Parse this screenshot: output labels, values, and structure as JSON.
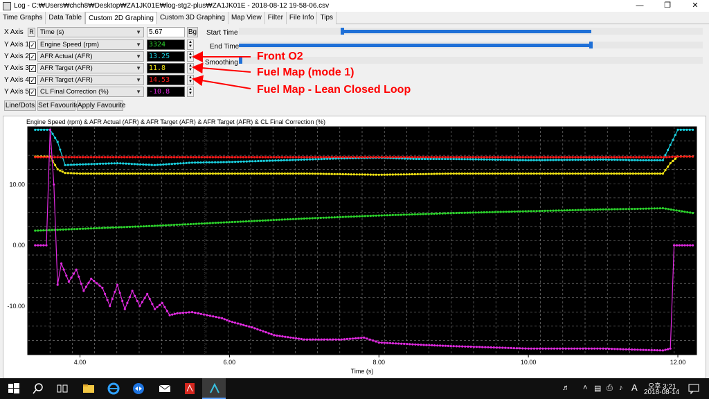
{
  "window": {
    "title": "Log - C:₩Users₩chch8₩Desktop₩ZA1JK01E₩log-stg2-plus₩ZA1JK01E - 2018-08-12 19-58-06.csv",
    "minimize": "—",
    "restore": "❐",
    "close": "✕"
  },
  "tabs": [
    "Time Graphs",
    "Data Table",
    "Custom 2D Graphing",
    "Custom 3D Graphing",
    "Map View",
    "Filter",
    "File Info",
    "Tips"
  ],
  "active_tab": "Custom 2D Graphing",
  "axes_panel": {
    "x_axis": {
      "label": "X Axis",
      "r_button": "R",
      "field": "Time (s)",
      "value": "5.67",
      "bg_button": "Bg"
    },
    "y_axes": [
      {
        "label": "Y Axis 1",
        "field": "Engine Speed (rpm)",
        "value": "3324",
        "color": "#2bd12b"
      },
      {
        "label": "Y Axis 2",
        "field": "AFR Actual (AFR)",
        "value": "13.25",
        "color": "#19d1e0"
      },
      {
        "label": "Y Axis 3",
        "field": "AFR Target (AFR)",
        "value": "11.8",
        "color": "#f2e414"
      },
      {
        "label": "Y Axis 4",
        "field": "AFR Target (AFR)",
        "value": "14.53",
        "color": "#ff1a1a"
      },
      {
        "label": "Y Axis 5",
        "field": "CL Final Correction (%)",
        "value": "-10.8",
        "color": "#e02ae0"
      }
    ],
    "buttons": {
      "line_dots": "Line/Dots",
      "set_favourite": "Set Favourite",
      "apply_favourite": "Apply Favourite"
    }
  },
  "time_controls": {
    "start_time_label": "Start Time",
    "end_time_label": "End Time",
    "smoothing_label": "Smoothing",
    "start_range": [
      0.22,
      0.76
    ],
    "end_range": [
      0.0,
      0.76
    ]
  },
  "annotations": [
    "Front O2",
    "Fuel Map (mode 1)",
    "Fuel Map - Lean Closed Loop"
  ],
  "annotation_color": "#ff0000",
  "chart_data": {
    "type": "line",
    "title": "Engine Speed (rpm) & AFR Actual (AFR) & AFR Target (AFR) & AFR Target (AFR) & CL Final Correction (%)",
    "xlabel": "Time (s)",
    "ylabel": "",
    "xlim": [
      3.3,
      12.25
    ],
    "ylim": [
      -18,
      19.5
    ],
    "xticks": [
      4.0,
      6.0,
      8.0,
      10.0,
      12.0
    ],
    "xtick_labels": [
      "4.00",
      "6.00",
      "8.00",
      "10.00",
      "12.00"
    ],
    "yticks": [
      10,
      0,
      -10
    ],
    "ytick_labels": [
      "10.00",
      "0.00",
      "-10.00"
    ],
    "background": "#000000",
    "grid": true,
    "cursor_x": 5.67,
    "series": [
      {
        "color": "#2bd12b",
        "x": [
          3.4,
          4.0,
          5.0,
          6.0,
          7.0,
          8.0,
          9.0,
          10.0,
          11.0,
          11.5,
          11.8,
          12.2
        ],
        "y": [
          2.4,
          2.7,
          3.2,
          3.8,
          4.4,
          4.9,
          5.3,
          5.6,
          5.9,
          6.0,
          6.1,
          5.3
        ]
      },
      {
        "color": "#19d1e0",
        "x": [
          3.4,
          3.6,
          3.7,
          3.8,
          4.0,
          4.5,
          5.0,
          5.5,
          6.0,
          6.5,
          7.0,
          7.5,
          8.0,
          8.5,
          9.0,
          10.0,
          11.0,
          11.5,
          11.8,
          11.9,
          12.0,
          12.2
        ],
        "y": [
          19.0,
          19.0,
          17.0,
          13.2,
          13.3,
          13.5,
          13.2,
          13.6,
          13.7,
          13.9,
          14.1,
          14.3,
          14.4,
          14.2,
          14.2,
          14.0,
          14.1,
          14.0,
          14.0,
          16.5,
          19.0,
          19.0
        ]
      },
      {
        "color": "#f2e414",
        "x": [
          3.4,
          3.6,
          3.7,
          3.8,
          4.0,
          5.0,
          6.0,
          7.0,
          8.0,
          9.0,
          10.0,
          11.0,
          11.8,
          11.9,
          12.0,
          12.2
        ],
        "y": [
          14.6,
          14.6,
          12.5,
          11.9,
          11.8,
          11.8,
          11.8,
          11.8,
          11.6,
          11.8,
          11.8,
          11.8,
          11.8,
          13.5,
          14.6,
          14.6
        ]
      },
      {
        "color": "#ff1a1a",
        "x": [
          3.4,
          3.7,
          4.0,
          6.0,
          8.0,
          10.0,
          11.85,
          12.0,
          12.2
        ],
        "y": [
          14.5,
          14.5,
          14.5,
          14.5,
          14.5,
          14.5,
          14.5,
          14.6,
          14.6
        ]
      },
      {
        "color": "#e02ae0",
        "x": [
          3.4,
          3.55,
          3.6,
          3.65,
          3.7,
          3.75,
          3.85,
          3.95,
          4.05,
          4.15,
          4.3,
          4.4,
          4.5,
          4.6,
          4.7,
          4.8,
          4.9,
          5.0,
          5.1,
          5.2,
          5.3,
          5.5,
          5.7,
          5.9,
          6.0,
          6.3,
          6.6,
          7.0,
          7.5,
          7.8,
          8.0,
          8.3,
          8.6,
          9.0,
          9.5,
          10.0,
          10.5,
          11.0,
          11.5,
          11.8,
          11.9,
          11.95,
          12.2
        ],
        "y": [
          0,
          0,
          19.0,
          10.0,
          -6.5,
          -3.0,
          -6.0,
          -4.0,
          -7.5,
          -5.5,
          -7.0,
          -10.0,
          -6.5,
          -10.5,
          -7.5,
          -10.0,
          -8.0,
          -10.5,
          -9.5,
          -11.5,
          -11.2,
          -11.0,
          -11.5,
          -12.0,
          -12.5,
          -13.5,
          -14.8,
          -15.5,
          -15.5,
          -15.2,
          -16.0,
          -16.2,
          -16.4,
          -16.6,
          -16.8,
          -17.0,
          -17.0,
          -17.0,
          -17.2,
          -17.3,
          -17.0,
          0,
          0
        ]
      }
    ]
  },
  "taskbar": {
    "time": "오후 3:21",
    "date": "2018-08-14",
    "ime": "A"
  }
}
